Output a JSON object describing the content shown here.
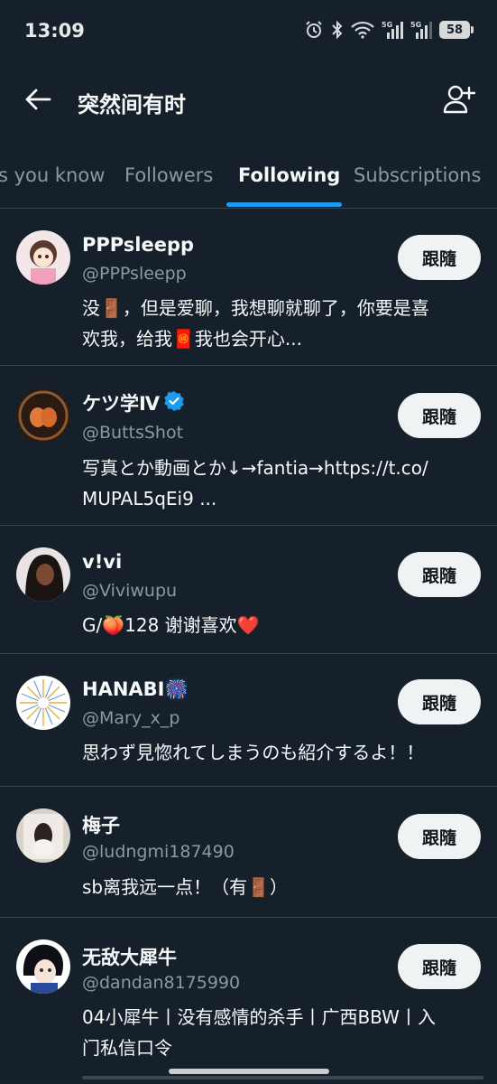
{
  "status_bar": {
    "time": "13:09",
    "network_1": "5G",
    "network_2": "5G",
    "battery": "58",
    "icons": [
      "alarm-icon",
      "bluetooth-icon",
      "wifi-icon",
      "signal-icon",
      "signal-icon",
      "battery-icon"
    ]
  },
  "header": {
    "title": "突然间有时",
    "back_icon": "arrow-left-icon",
    "add_user_icon": "add-user-icon"
  },
  "tabs": [
    {
      "label": "s you know",
      "active": false
    },
    {
      "label": "Followers",
      "active": false
    },
    {
      "label": "Following",
      "active": true
    },
    {
      "label": "Subscriptions",
      "active": false
    }
  ],
  "accent_color": "#1d9bf0",
  "users": [
    {
      "name": "PPPsleepp",
      "handle": "@PPPsleepp",
      "bio_line1": "没🚪，但是爱聊，我想聊就聊了，你要是喜",
      "bio_line2": "欢我，给我🧧我也会开心...",
      "button": "跟隨",
      "verified": false
    },
    {
      "name": "ケツ学Ⅳ",
      "handle": "@ButtsShot",
      "bio_line1": "写真とか動画とか↓→fantia→https://t.co/",
      "bio_line2": "MUPAL5qEi9 ...",
      "button": "跟隨",
      "verified": true
    },
    {
      "name": "v!vi",
      "handle": "@Viviwupu",
      "bio_line1": "G/🍑128 谢谢喜欢❤️",
      "button": "跟隨",
      "verified": false
    },
    {
      "name": "HANABI🎆",
      "handle": "@Mary_x_p",
      "bio_line1": "思わず見惚れてしまうのも紹介するよ！！",
      "button": "跟隨",
      "verified": false
    },
    {
      "name": "梅子",
      "handle": "@ludngmi187490",
      "bio_line1": "sb离我远一点！（有🚪）",
      "button": "跟隨",
      "verified": false
    },
    {
      "name": "无敌大犀牛",
      "handle": "@dandan8175990",
      "bio_line1": "04小犀牛丨没有感情的杀手丨广西BBW丨入",
      "bio_line2": "门私信口令",
      "button": "跟隨",
      "verified": false
    }
  ]
}
